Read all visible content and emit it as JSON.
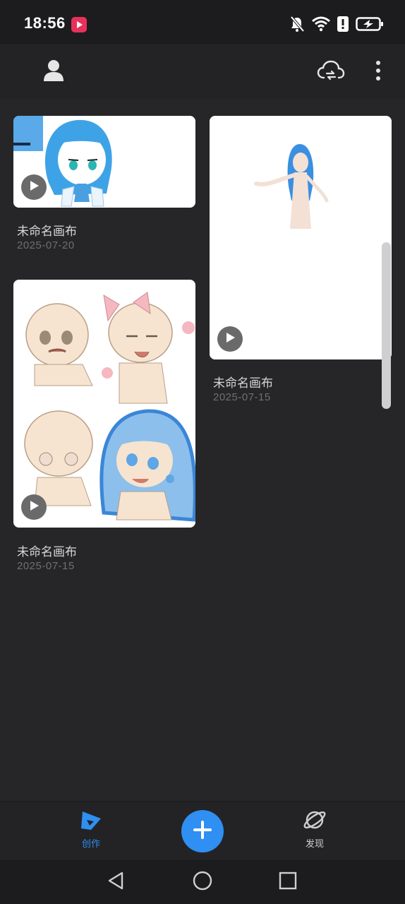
{
  "status_bar": {
    "time": "18:56",
    "icons": [
      "app-notification-icon",
      "bell-muted-icon",
      "wifi-icon",
      "alert-icon",
      "battery-charging-icon"
    ]
  },
  "header": {
    "icons": [
      "profile-icon",
      "cloud-sync-icon",
      "more-vert-icon"
    ]
  },
  "artworks": [
    {
      "title": "未命名画布",
      "date": "2025-07-20"
    },
    {
      "title": "未命名画布",
      "date": "2025-07-15"
    },
    {
      "title": "未命名画布",
      "date": "2025-07-15"
    }
  ],
  "bottom_nav": {
    "create_label": "创作",
    "discover_label": "发现",
    "active_color": "#2f8ff2",
    "inactive_color": "#cfcfcf"
  },
  "system_nav": [
    "back-icon",
    "home-icon",
    "recents-icon"
  ]
}
